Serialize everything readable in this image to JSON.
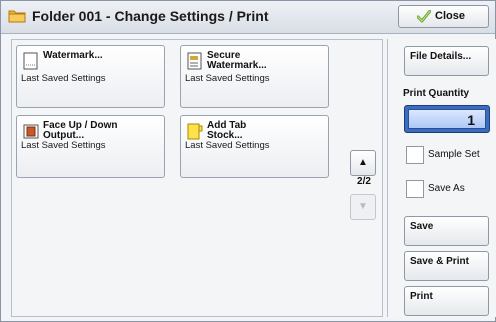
{
  "titlebar": {
    "title": "Folder 001 - Change Settings / Print",
    "close_label": "Close"
  },
  "tiles": [
    {
      "name": "Watermark...",
      "sub": "Last Saved Settings",
      "icon": "watermark-icon"
    },
    {
      "name": "Secure\nWatermark...",
      "sub": "Last Saved Settings",
      "icon": "secure-watermark-icon"
    },
    {
      "name": "Face Up / Down\nOutput...",
      "sub": "Last Saved Settings",
      "icon": "face-up-down-icon"
    },
    {
      "name": "Add Tab\nStock...",
      "sub": "Last Saved Settings",
      "icon": "tab-stock-icon"
    }
  ],
  "pager": {
    "indicator": "2/2",
    "up_glyph": "▲",
    "down_glyph": "▼"
  },
  "right": {
    "file_details": "File Details...",
    "print_quantity_label": "Print Quantity",
    "print_quantity_value": "1",
    "sample_set": "Sample Set",
    "save_as": "Save As",
    "save": "Save",
    "save_print": "Save & Print",
    "print": "Print"
  },
  "colors": {
    "accent": "#3a6dbf",
    "folder": "#f2b233"
  }
}
